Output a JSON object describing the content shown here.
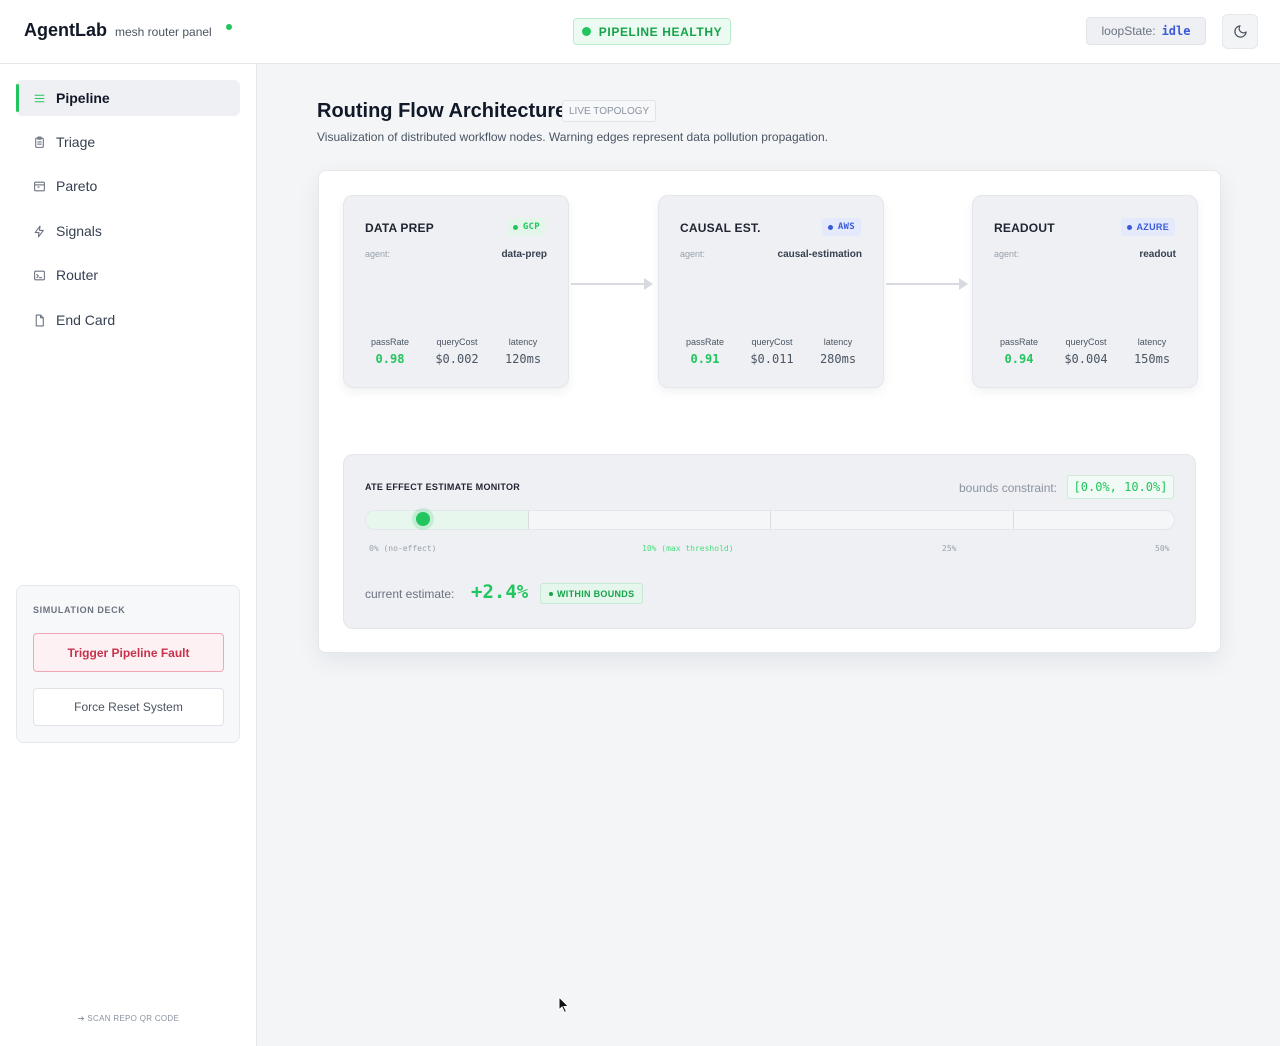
{
  "header": {
    "brand": "AgentLab",
    "subtitle": "mesh router panel",
    "status": "PIPELINE HEALTHY",
    "loop_state_label": "loopState:",
    "loop_state_value": "idle"
  },
  "sidebar": {
    "items": [
      {
        "label": "Pipeline",
        "icon": "list-icon"
      },
      {
        "label": "Triage",
        "icon": "clipboard-icon"
      },
      {
        "label": "Pareto",
        "icon": "window-icon"
      },
      {
        "label": "Signals",
        "icon": "bolt-icon"
      },
      {
        "label": "Router",
        "icon": "terminal-icon"
      },
      {
        "label": "End Card",
        "icon": "file-icon"
      }
    ],
    "active_index": 0,
    "sim_deck": {
      "title": "SIMULATION DECK",
      "fault_button": "Trigger Pipeline Fault",
      "reset_button": "Force Reset System"
    },
    "footer_link": "➔ SCAN REPO QR CODE"
  },
  "main": {
    "title": "Routing Flow Architecture",
    "badge": "LIVE TOPOLOGY",
    "description": "Visualization of distributed workflow nodes. Warning edges represent data pollution propagation.",
    "nodes": [
      {
        "title": "DATA PREP",
        "cloud": "GCP",
        "agent_label": "agent:",
        "agent": "data-prep",
        "metrics": [
          {
            "label": "passRate",
            "value": "0.98"
          },
          {
            "label": "queryCost",
            "value": "$0.002"
          },
          {
            "label": "latency",
            "value": "120ms"
          }
        ]
      },
      {
        "title": "CAUSAL EST.",
        "cloud": "AWS",
        "agent_label": "agent:",
        "agent": "causal-estimation",
        "metrics": [
          {
            "label": "passRate",
            "value": "0.91"
          },
          {
            "label": "queryCost",
            "value": "$0.011"
          },
          {
            "label": "latency",
            "value": "280ms"
          }
        ]
      },
      {
        "title": "READOUT",
        "cloud": "AZURE",
        "agent_label": "agent:",
        "agent": "readout",
        "metrics": [
          {
            "label": "passRate",
            "value": "0.94"
          },
          {
            "label": "queryCost",
            "value": "$0.004"
          },
          {
            "label": "latency",
            "value": "150ms"
          }
        ]
      }
    ],
    "monitor": {
      "title": "ATE EFFECT ESTIMATE MONITOR",
      "bounds_label": "bounds constraint:",
      "bounds_value": "[0.0%, 10.0%]",
      "axis": [
        "0% (no-effect)",
        "10% (max threshold)",
        "25%",
        "50%"
      ],
      "estimate_label": "current estimate:",
      "estimate_value": "+2.4%",
      "estimate_percent": 2.4,
      "status": "WITHIN BOUNDS"
    }
  },
  "colors": {
    "accent_green": "#22c55e",
    "danger": "#c8324b",
    "gcp": "#22c55e",
    "aws": "#3b5bdb",
    "azure": "#3b5bdb"
  }
}
